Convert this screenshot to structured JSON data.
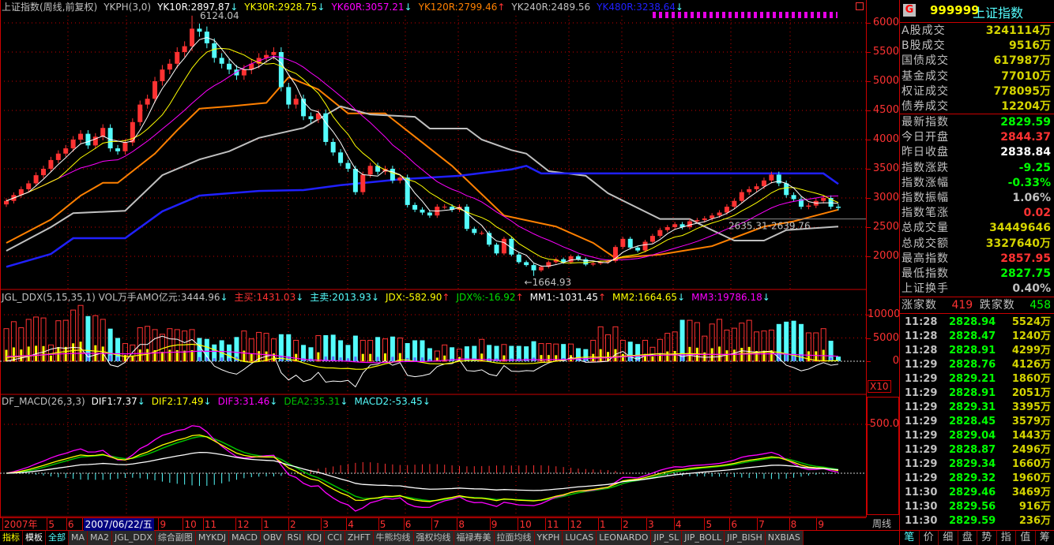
{
  "main_header": [
    {
      "text": "上证指数(周线,前复权)",
      "color": "#c0c0c0",
      "arrow": ""
    },
    {
      "text": "YKPH(3,0)",
      "color": "#c0c0c0",
      "arrow": ""
    },
    {
      "text": "YK10R:2897.87",
      "color": "#ffffff",
      "arrow": "↓"
    },
    {
      "text": "YK30R:2928.75",
      "color": "#ffff00",
      "arrow": "↓"
    },
    {
      "text": "YK60R:3057.21",
      "color": "#ff00ff",
      "arrow": "↓"
    },
    {
      "text": "YK120R:2799.46",
      "color": "#ff8000",
      "arrow": "↑"
    },
    {
      "text": "YK240R:2489.56",
      "color": "#c0c0c0",
      "arrow": ""
    },
    {
      "text": "YK480R:3238.64",
      "color": "#2020ff",
      "arrow": "↓"
    }
  ],
  "ddx_header": [
    {
      "text": "JGL_DDX(5,15,35,1) VOL万手AMO亿元:3444.96",
      "color": "#c0c0c0",
      "arrow": "↓"
    },
    {
      "text": "主买:1431.03",
      "color": "#ff3232",
      "arrow": "↓"
    },
    {
      "text": "主卖:2013.93",
      "color": "#54fcfc",
      "arrow": "↓"
    },
    {
      "text": "JDX:-582.90",
      "color": "#ffff00",
      "arrow": "↑"
    },
    {
      "text": "JDX%:-16.92",
      "color": "#00e000",
      "arrow": "↑"
    },
    {
      "text": "MM1:-1031.45",
      "color": "#ffffff",
      "arrow": "↑"
    },
    {
      "text": "MM2:1664.65",
      "color": "#ffff00",
      "arrow": "↓"
    },
    {
      "text": "MM3:19786.18",
      "color": "#ff00ff",
      "arrow": "↓"
    }
  ],
  "macd_header": [
    {
      "text": "DF_MACD(26,3,3)",
      "color": "#c0c0c0",
      "arrow": ""
    },
    {
      "text": "DIF1:7.37",
      "color": "#ffffff",
      "arrow": "↓"
    },
    {
      "text": "DIF2:17.49",
      "color": "#ffff00",
      "arrow": "↓"
    },
    {
      "text": "DIF3:31.46",
      "color": "#ff00ff",
      "arrow": "↓"
    },
    {
      "text": "DEA2:35.31",
      "color": "#00c000",
      "arrow": "↓"
    },
    {
      "text": "MACD2:-53.45",
      "color": "#54fcfc",
      "arrow": "↓"
    }
  ],
  "axes": {
    "price_ticks": [
      "2000",
      "2500",
      "3000",
      "3500",
      "4000",
      "4500",
      "5000",
      "5500",
      "6000"
    ],
    "volume_ticks": [
      "0",
      "5000",
      "10000"
    ],
    "volume_multiplier": "X10",
    "macd_ticks": [
      "500.0"
    ],
    "period": "周线"
  },
  "annotations": {
    "high_label": "6124.04",
    "low_label": "←1664.93",
    "range_label": "2635.31-2639.76",
    "range_level": 2640
  },
  "chart_data": {
    "type": "candlestick",
    "closes": [
      2950,
      3050,
      3150,
      3250,
      3390,
      3500,
      3650,
      3760,
      3850,
      4000,
      4100,
      3900,
      4050,
      4200,
      3850,
      3800,
      3950,
      4300,
      4600,
      4700,
      5000,
      5200,
      5300,
      5500,
      5600,
      5900,
      5850,
      5650,
      5400,
      5300,
      5200,
      5100,
      5200,
      5300,
      5400,
      5450,
      5500,
      4900,
      4600,
      4700,
      4400,
      4350,
      4450,
      3960,
      3780,
      3600,
      3500,
      3100,
      3400,
      3550,
      3450,
      3500,
      3300,
      3350,
      2880,
      2800,
      2750,
      2700,
      2850,
      2850,
      2800,
      2850,
      2470,
      2400,
      2400,
      2200,
      2050,
      2300,
      2030,
      1900,
      1850,
      1760,
      1820,
      1900,
      1950,
      1900,
      2000,
      1950,
      1860,
      1880,
      1900,
      1920,
      2160,
      2300,
      2150,
      2100,
      2250,
      2350,
      2450,
      2500,
      2550,
      2500,
      2600,
      2620,
      2650,
      2700,
      2750,
      2850,
      2950,
      3100,
      3150,
      3200,
      3300,
      3400,
      3250,
      3050,
      2980,
      2850,
      2870,
      2950,
      3000,
      2850,
      2830
    ],
    "high": 6124.04,
    "low": 1664.93,
    "volumes": [
      7000,
      8500,
      7200,
      9000,
      9500,
      9300,
      3500,
      8700,
      8800,
      11000,
      12000,
      9700,
      9800,
      9000,
      7000,
      5000,
      3800,
      3500,
      7200,
      7500,
      6800,
      5800,
      7000,
      6800,
      6500,
      6800,
      5000,
      4800,
      3600,
      4500,
      3600,
      5200,
      6500,
      4800,
      6200,
      6000,
      4800,
      5800,
      5800,
      4500,
      3500,
      3000,
      5500,
      5600,
      5700,
      4500,
      3500,
      5500,
      4500,
      4500,
      5200,
      4800,
      5300,
      5000,
      3900,
      4500,
      4500,
      2800,
      2200,
      3500,
      3000,
      2600,
      3200,
      3300,
      4700,
      3500,
      3300,
      3600,
      3300,
      3300,
      3200,
      4300,
      3800,
      3800,
      3700,
      3700,
      3700,
      2800,
      2600,
      4500,
      7400,
      5700,
      7400,
      4500,
      4200,
      3700,
      4500,
      3000,
      4700,
      6000,
      6300,
      8900,
      8800,
      8300,
      5400,
      8000,
      9000,
      6700,
      7100,
      8200,
      8800,
      6300,
      6500,
      6700,
      8000,
      8500,
      8700,
      8000,
      6100,
      6100,
      7000,
      4400,
      1000
    ],
    "long_lines": [
      {
        "name": "YK120R",
        "color": "#ff8000",
        "points": [
          [
            0,
            2230
          ],
          [
            6,
            2630
          ],
          [
            10,
            3040
          ],
          [
            13,
            3260
          ],
          [
            15,
            3260
          ],
          [
            20,
            3760
          ],
          [
            23,
            4160
          ],
          [
            26,
            4530
          ],
          [
            30,
            4570
          ],
          [
            35,
            4630
          ],
          [
            38,
            5070
          ],
          [
            42,
            4860
          ],
          [
            46,
            4450
          ],
          [
            51,
            4450
          ],
          [
            55,
            4050
          ],
          [
            60,
            3550
          ],
          [
            67,
            2700
          ],
          [
            74,
            2510
          ],
          [
            79,
            2230
          ],
          [
            82,
            1970
          ],
          [
            88,
            2030
          ],
          [
            95,
            2175
          ],
          [
            102,
            2510
          ],
          [
            106,
            2600
          ],
          [
            112,
            2800
          ]
        ]
      },
      {
        "name": "YK240R",
        "color": "#c0c0c0",
        "points": [
          [
            0,
            2095
          ],
          [
            6,
            2500
          ],
          [
            9,
            2740
          ],
          [
            16,
            2780
          ],
          [
            21,
            3390
          ],
          [
            26,
            3660
          ],
          [
            30,
            3800
          ],
          [
            34,
            4030
          ],
          [
            40,
            4200
          ],
          [
            45,
            4570
          ],
          [
            49,
            4430
          ],
          [
            55,
            4390
          ],
          [
            57,
            4190
          ],
          [
            62,
            4190
          ],
          [
            64,
            4000
          ],
          [
            68,
            3820
          ],
          [
            70,
            3760
          ],
          [
            73,
            3460
          ],
          [
            78,
            3380
          ],
          [
            81,
            3080
          ],
          [
            88,
            2640
          ],
          [
            92,
            2640
          ],
          [
            94,
            2510
          ],
          [
            98,
            2270
          ],
          [
            102,
            2270
          ],
          [
            105,
            2450
          ],
          [
            112,
            2510
          ]
        ]
      },
      {
        "name": "YK480R",
        "color": "#2020ff",
        "points": [
          [
            0,
            1820
          ],
          [
            6,
            2040
          ],
          [
            9,
            2310
          ],
          [
            16,
            2310
          ],
          [
            21,
            2770
          ],
          [
            26,
            3040
          ],
          [
            34,
            3120
          ],
          [
            40,
            3135
          ],
          [
            45,
            3220
          ],
          [
            53,
            3320
          ],
          [
            61,
            3380
          ],
          [
            68,
            3490
          ],
          [
            70,
            3550
          ],
          [
            72,
            3420
          ],
          [
            110,
            3420
          ],
          [
            112,
            3240
          ]
        ]
      }
    ],
    "colors": {
      "up": "#ff3232",
      "down": "#54fcfc",
      "ma_short": "#ffffff",
      "ma_mid": "#ffff00",
      "ma_long": "#ff00ff"
    }
  },
  "date_axis": [
    {
      "label": "2007年",
      "bar": 0
    },
    {
      "label": "5",
      "bar": 6
    },
    {
      "label": "6",
      "bar": 8.6
    },
    {
      "label": "2007/06/22/五",
      "bar": 10.7,
      "selected": true
    },
    {
      "label": "9",
      "bar": 21
    },
    {
      "label": "10",
      "bar": 24.3
    },
    {
      "label": "11",
      "bar": 27
    },
    {
      "label": "12",
      "bar": 31.4
    },
    {
      "label": "1",
      "bar": 34.9
    },
    {
      "label": "2",
      "bar": 38.5
    },
    {
      "label": "3",
      "bar": 42.9
    },
    {
      "label": "4",
      "bar": 46.3
    },
    {
      "label": "5",
      "bar": 50.6
    },
    {
      "label": "6",
      "bar": 54
    },
    {
      "label": "7",
      "bar": 57.8
    },
    {
      "label": "8",
      "bar": 61.2
    },
    {
      "label": "9",
      "bar": 65.6
    },
    {
      "label": "10",
      "bar": 69.4
    },
    {
      "label": "11",
      "bar": 73.1
    },
    {
      "label": "12",
      "bar": 76.2
    },
    {
      "label": "1",
      "bar": 80.2
    },
    {
      "label": "2",
      "bar": 83.3
    },
    {
      "label": "3",
      "bar": 86.7
    },
    {
      "label": "4",
      "bar": 90.4
    },
    {
      "label": "5",
      "bar": 94.5
    },
    {
      "label": "6",
      "bar": 97.9
    },
    {
      "label": "7",
      "bar": 101.6
    },
    {
      "label": "8",
      "bar": 105.9
    },
    {
      "label": "9",
      "bar": 109.6
    }
  ],
  "bottom_tabs": [
    {
      "label": "指标",
      "color": "#ffff00"
    },
    {
      "label": "模板",
      "color": "#ffffff"
    },
    {
      "label": "全部",
      "color": "#54fcfc"
    },
    {
      "label": "MA"
    },
    {
      "label": "MA2"
    },
    {
      "label": "JGL_DDX"
    },
    {
      "label": "综合副图"
    },
    {
      "label": "MYKDJ"
    },
    {
      "label": "MACD"
    },
    {
      "label": "OBV"
    },
    {
      "label": "RSI"
    },
    {
      "label": "KDJ"
    },
    {
      "label": "CCI"
    },
    {
      "label": "ZHFT"
    },
    {
      "label": "牛熊均线"
    },
    {
      "label": "强权均线"
    },
    {
      "label": "福禄寿美"
    },
    {
      "label": "拉面均线"
    },
    {
      "label": "YKPH"
    },
    {
      "label": "LUCAS"
    },
    {
      "label": "LEONARDO"
    },
    {
      "label": "JIP_SL"
    },
    {
      "label": "JIP_BOLL"
    },
    {
      "label": "JIP_BISH"
    },
    {
      "label": "NXBIAS"
    }
  ],
  "right_panel": {
    "badge": "G",
    "code": "999999",
    "name": "上证指数",
    "turnover": [
      {
        "label": "A股成交",
        "value": "3241114万",
        "color": "#d4d400"
      },
      {
        "label": "B股成交",
        "value": "9516万",
        "color": "#d4d400"
      },
      {
        "label": "国债成交",
        "value": "617987万",
        "color": "#d4d400"
      },
      {
        "label": "基金成交",
        "value": "77010万",
        "color": "#d4d400"
      },
      {
        "label": "权证成交",
        "value": "778095万",
        "color": "#d4d400"
      },
      {
        "label": "债券成交",
        "value": "12204万",
        "color": "#d4d400"
      }
    ],
    "quote": [
      {
        "label": "最新指数",
        "value": "2829.59",
        "color": "#00ff00"
      },
      {
        "label": "今日开盘",
        "value": "2844.37",
        "color": "#ff3232"
      },
      {
        "label": "昨日收盘",
        "value": "2838.84",
        "color": "#ffffff"
      },
      {
        "label": "指数涨跌",
        "value": "-9.25",
        "color": "#00ff00"
      },
      {
        "label": "指数涨幅",
        "value": "-0.33%",
        "color": "#00ff00"
      },
      {
        "label": "指数振幅",
        "value": "1.06%",
        "color": "#c0c0c0"
      },
      {
        "label": "指数笔涨",
        "value": "0.02",
        "color": "#ff3232"
      },
      {
        "label": "总成交量",
        "value": "34449646",
        "color": "#d4d400"
      },
      {
        "label": "总成交额",
        "value": "3327640万",
        "color": "#d4d400"
      },
      {
        "label": "最高指数",
        "value": "2857.95",
        "color": "#ff3232"
      },
      {
        "label": "最低指数",
        "value": "2827.75",
        "color": "#00ff00"
      },
      {
        "label": "上证换手",
        "value": "0.40%",
        "color": "#c0c0c0"
      }
    ],
    "breadth": {
      "up_label": "涨家数",
      "up_value": "419",
      "down_label": "跌家数",
      "down_value": "458"
    },
    "ticks": [
      {
        "time": "11:28",
        "price": "2828.94",
        "vol": "5524万"
      },
      {
        "time": "11:28",
        "price": "2828.47",
        "vol": "1240万"
      },
      {
        "time": "11:28",
        "price": "2828.91",
        "vol": "4299万"
      },
      {
        "time": "11:29",
        "price": "2828.76",
        "vol": "4126万"
      },
      {
        "time": "11:29",
        "price": "2829.21",
        "vol": "1860万"
      },
      {
        "time": "11:29",
        "price": "2828.91",
        "vol": "2051万"
      },
      {
        "time": "11:29",
        "price": "2829.31",
        "vol": "3395万"
      },
      {
        "time": "11:29",
        "price": "2828.45",
        "vol": "3579万"
      },
      {
        "time": "11:29",
        "price": "2829.04",
        "vol": "1443万"
      },
      {
        "time": "11:29",
        "price": "2828.87",
        "vol": "2496万"
      },
      {
        "time": "11:29",
        "price": "2829.34",
        "vol": "1660万"
      },
      {
        "time": "11:29",
        "price": "2829.32",
        "vol": "1960万"
      },
      {
        "time": "11:30",
        "price": "2829.46",
        "vol": "3469万"
      },
      {
        "time": "11:30",
        "price": "2829.56",
        "vol": "916万"
      },
      {
        "time": "11:30",
        "price": "2829.59",
        "vol": "236万"
      }
    ],
    "tabs": [
      "笔",
      "价",
      "细",
      "盘",
      "势",
      "指",
      "值",
      "筹"
    ]
  }
}
